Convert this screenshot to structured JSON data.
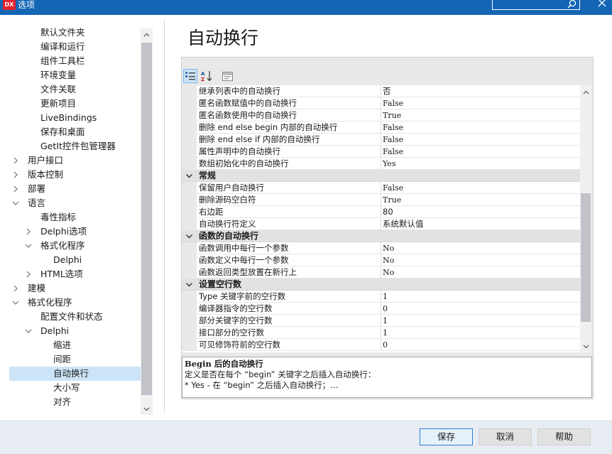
{
  "window": {
    "logo": "DX",
    "title": "选项"
  },
  "tree": {
    "items": [
      {
        "label": "默认文件夹",
        "level": 2,
        "expander": "none",
        "selected": false
      },
      {
        "label": "编译和运行",
        "level": 2,
        "expander": "none",
        "selected": false
      },
      {
        "label": "组件工具栏",
        "level": 2,
        "expander": "none",
        "selected": false
      },
      {
        "label": "环境变量",
        "level": 2,
        "expander": "none",
        "selected": false
      },
      {
        "label": "文件关联",
        "level": 2,
        "expander": "none",
        "selected": false
      },
      {
        "label": "更新项目",
        "level": 2,
        "expander": "none",
        "selected": false
      },
      {
        "label": "LiveBindings",
        "level": 2,
        "expander": "none",
        "selected": false
      },
      {
        "label": "保存和桌面",
        "level": 2,
        "expander": "none",
        "selected": false
      },
      {
        "label": "GetIt控件包管理器",
        "level": 2,
        "expander": "none",
        "selected": false
      },
      {
        "label": "用户接口",
        "level": 1,
        "expander": "collapsed",
        "selected": false
      },
      {
        "label": "版本控制",
        "level": 1,
        "expander": "collapsed",
        "selected": false
      },
      {
        "label": "部署",
        "level": 1,
        "expander": "collapsed",
        "selected": false
      },
      {
        "label": "语言",
        "level": 1,
        "expander": "expanded",
        "selected": false
      },
      {
        "label": "毒性指标",
        "level": 2,
        "expander": "none",
        "selected": false
      },
      {
        "label": "Delphi选项",
        "level": 2,
        "expander": "collapsed",
        "selected": false
      },
      {
        "label": "格式化程序",
        "level": 2,
        "expander": "expanded",
        "selected": false
      },
      {
        "label": "Delphi",
        "level": 3,
        "expander": "none",
        "selected": false
      },
      {
        "label": "HTML选项",
        "level": 2,
        "expander": "collapsed",
        "selected": false
      },
      {
        "label": "建模",
        "level": 1,
        "expander": "collapsed",
        "selected": false
      },
      {
        "label": "格式化程序",
        "level": 1,
        "expander": "expanded",
        "selected": false
      },
      {
        "label": "配置文件和状态",
        "level": 2,
        "expander": "none",
        "selected": false
      },
      {
        "label": "Delphi",
        "level": 2,
        "expander": "expanded",
        "selected": false
      },
      {
        "label": "缩进",
        "level": 3,
        "expander": "none",
        "selected": false
      },
      {
        "label": "间距",
        "level": 3,
        "expander": "none",
        "selected": false
      },
      {
        "label": "自动换行",
        "level": 3,
        "expander": "none",
        "selected": true
      },
      {
        "label": "大小写",
        "level": 3,
        "expander": "none",
        "selected": false
      },
      {
        "label": "对齐",
        "level": 3,
        "expander": "none",
        "selected": false
      }
    ]
  },
  "page": {
    "title": "自动换行"
  },
  "grid": {
    "rows": [
      {
        "kind": "prop",
        "name": "继承列表中的自动换行",
        "value": "否",
        "mono": false
      },
      {
        "kind": "prop",
        "name": "匿名函数赋值中的自动换行",
        "value": "False",
        "mono": true
      },
      {
        "kind": "prop",
        "name": "匿名函数使用中的自动换行",
        "value": "True",
        "mono": true
      },
      {
        "kind": "prop",
        "name": "删除 end else begin 内部的自动换行",
        "value": "False",
        "mono": true
      },
      {
        "kind": "prop",
        "name": "删除 end else if 内部的自动换行",
        "value": "False",
        "mono": true
      },
      {
        "kind": "prop",
        "name": "属性声明中的自动换行",
        "value": "False",
        "mono": true
      },
      {
        "kind": "prop",
        "name": "数组初始化中的自动换行",
        "value": "Yes",
        "mono": true
      },
      {
        "kind": "cat",
        "name": "常规"
      },
      {
        "kind": "prop",
        "name": "保留用户自动换行",
        "value": "False",
        "mono": true
      },
      {
        "kind": "prop",
        "name": "删除源码空白符",
        "value": "True",
        "mono": true
      },
      {
        "kind": "prop",
        "name": "右边距",
        "value": "80",
        "mono": false
      },
      {
        "kind": "prop",
        "name": "自动换行符定义",
        "value": "系统默认值",
        "mono": false
      },
      {
        "kind": "cat",
        "name": "函数的自动换行"
      },
      {
        "kind": "prop",
        "name": "函数调用中每行一个参数",
        "value": "No",
        "mono": true
      },
      {
        "kind": "prop",
        "name": "函数定义中每行一个参数",
        "value": "No",
        "mono": true
      },
      {
        "kind": "prop",
        "name": "函数返回类型放置在新行上",
        "value": "No",
        "mono": true
      },
      {
        "kind": "cat",
        "name": "设置空行数"
      },
      {
        "kind": "prop",
        "name": "Type 关键字前的空行数",
        "value": "1",
        "mono": true
      },
      {
        "kind": "prop",
        "name": "编译器指令的空行数",
        "value": "0",
        "mono": true
      },
      {
        "kind": "prop",
        "name": "部分关键字的空行数",
        "value": "1",
        "mono": true
      },
      {
        "kind": "prop",
        "name": "接口部分的空行数",
        "value": "1",
        "mono": true
      },
      {
        "kind": "prop",
        "name": "可见修饰符前的空行数",
        "value": "0",
        "mono": true
      }
    ]
  },
  "description": {
    "title": "Begin 后的自动换行",
    "line1": "定义是否在每个 “begin” 关键字之后插入自动换行：",
    "line2": " * Yes - 在 “begin” 之后插入自动换行；…"
  },
  "buttons": {
    "ok": "保存",
    "cancel": "取消",
    "help": "帮助"
  },
  "colors": {
    "titlebar": "#1565b5",
    "selection": "#cce4f7",
    "accent_border": "#2c7cd4"
  }
}
